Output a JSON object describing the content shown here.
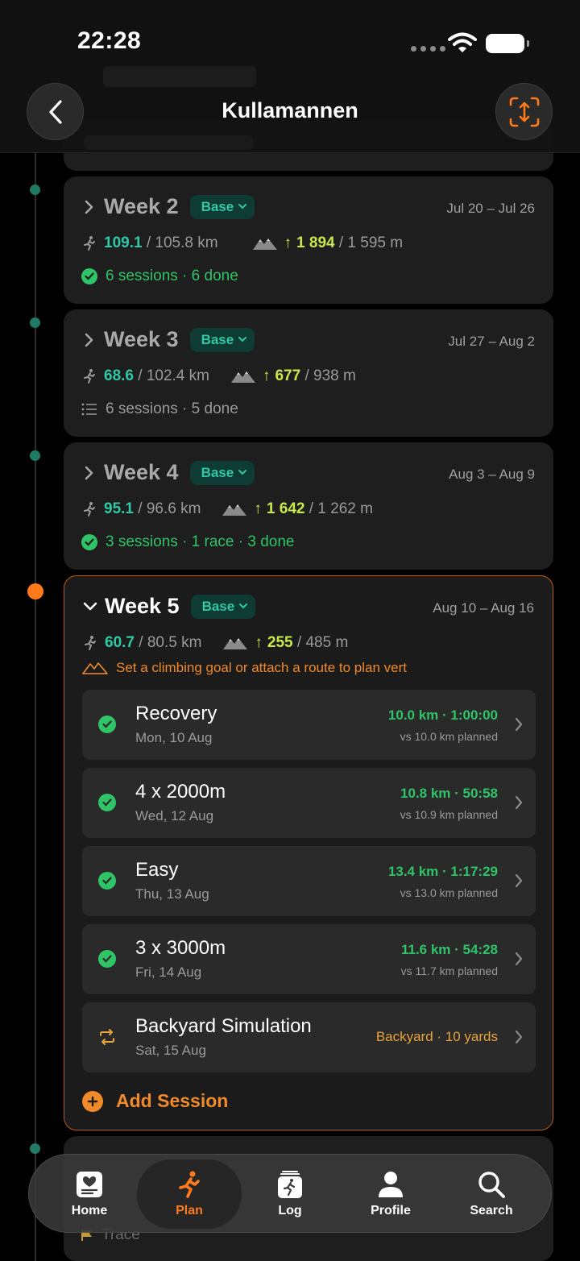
{
  "status": {
    "time": "22:28"
  },
  "header": {
    "title": "Kullamannen"
  },
  "weeks": [
    {
      "title": "Week 2",
      "badge": "Base",
      "dates": "Jul 20 – Jul 26",
      "distance_done": "109.1",
      "distance_planned": "/ 105.8 km",
      "elev_done": "1 894",
      "elev_planned": "/ 1 595 m",
      "sessions_summary": "6 sessions · 6 done"
    },
    {
      "title": "Week 3",
      "badge": "Base",
      "dates": "Jul 27 – Aug 2",
      "distance_done": "68.6",
      "distance_planned": "/ 102.4 km",
      "elev_done": "677",
      "elev_planned": "/ 938 m",
      "sessions_summary": "6 sessions · 5 done"
    },
    {
      "title": "Week 4",
      "badge": "Base",
      "dates": "Aug 3 – Aug 9",
      "distance_done": "95.1",
      "distance_planned": "/ 96.6 km",
      "elev_done": "1 642",
      "elev_planned": "/ 1 262 m",
      "sessions_summary": "3 sessions · 1 race · 3 done"
    },
    {
      "title": "Week 5",
      "badge": "Base",
      "dates": "Aug 10 – Aug 16",
      "distance_done": "60.7",
      "distance_planned": "/ 80.5 km",
      "elev_done": "255",
      "elev_planned": "/ 485 m",
      "warning": "Set a climbing goal or attach a route to plan vert",
      "sessions": [
        {
          "name": "Recovery",
          "date": "Mon, 10 Aug",
          "metric": "10.0 km · 1:00:00",
          "planned": "vs 10.0 km planned"
        },
        {
          "name": "4 x 2000m",
          "date": "Wed, 12 Aug",
          "metric": "10.8 km · 50:58",
          "planned": "vs 10.9 km planned"
        },
        {
          "name": "Easy",
          "date": "Thu, 13 Aug",
          "metric": "13.4 km · 1:17:29",
          "planned": "vs 13.0 km planned"
        },
        {
          "name": "3 x 3000m",
          "date": "Fri, 14 Aug",
          "metric": "11.6 km · 54:28",
          "planned": "vs 11.7 km planned"
        },
        {
          "name": "Backyard Simulation",
          "date": "Sat, 15 Aug",
          "metric": "Backyard · 10 yards"
        }
      ],
      "add_session": "Add Session"
    }
  ],
  "next_card": {
    "label": "Trace"
  },
  "tabbar": {
    "items": [
      {
        "label": "Home",
        "icon": "home-icon"
      },
      {
        "label": "Plan",
        "icon": "runner-icon",
        "active": true
      },
      {
        "label": "Log",
        "icon": "log-icon"
      },
      {
        "label": "Profile",
        "icon": "person-icon"
      },
      {
        "label": "Search",
        "icon": "search-icon"
      }
    ]
  },
  "colors": {
    "accent": "#ff7a1a",
    "done_green": "#2fc467",
    "teal": "#2fc9a5",
    "elev_yellow": "#c9e84a"
  }
}
